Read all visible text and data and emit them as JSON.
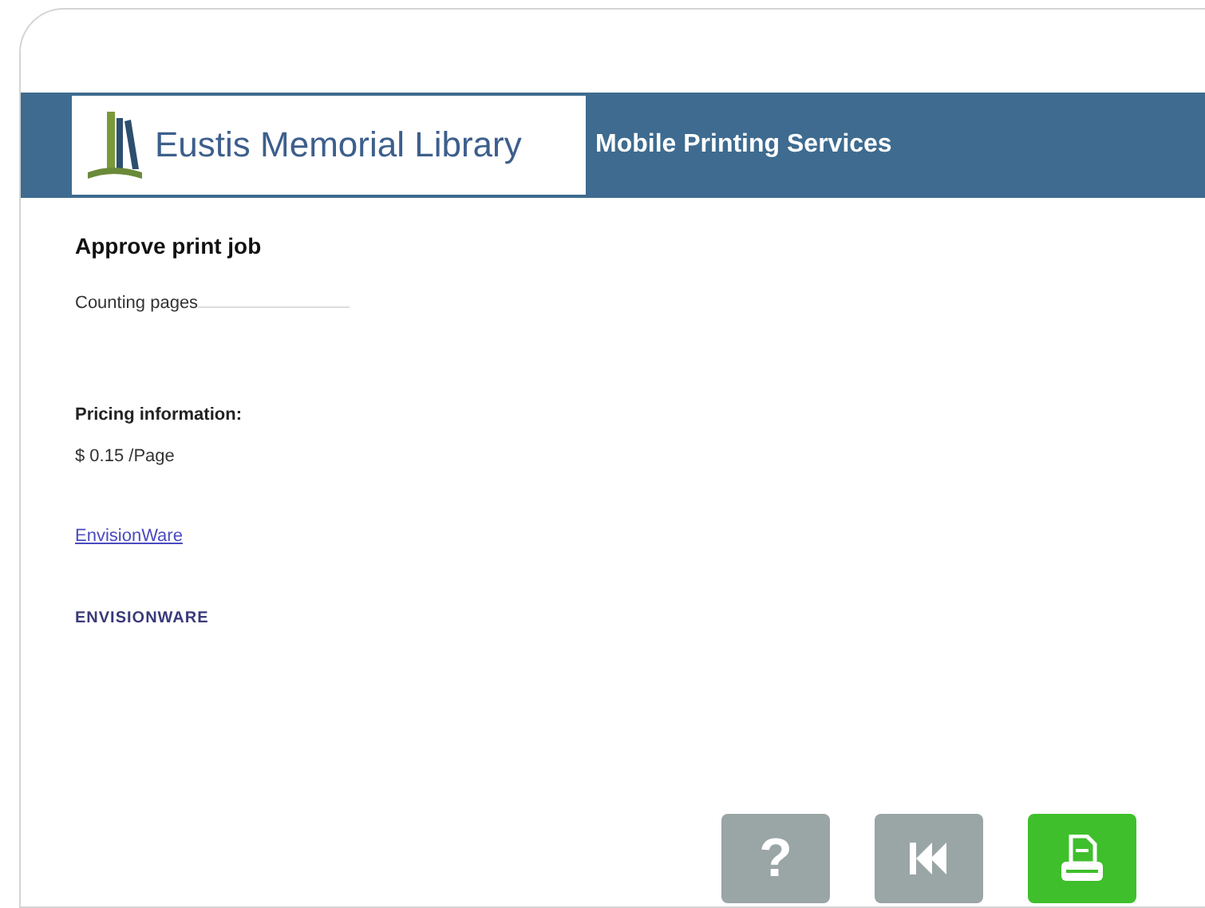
{
  "header": {
    "logo_title": "Eustis Memorial Library",
    "title": "Mobile Printing Services"
  },
  "heading": "Approve print job",
  "status": "Counting pages",
  "pricing": {
    "label": "Pricing information:",
    "price": "$ 0.15 /Page"
  },
  "link": "EnvisionWare",
  "brand": "ENVISIONWARE",
  "buttons": [
    {
      "kind": "help",
      "glyph": "?"
    },
    {
      "kind": "back"
    },
    {
      "kind": "print"
    }
  ]
}
